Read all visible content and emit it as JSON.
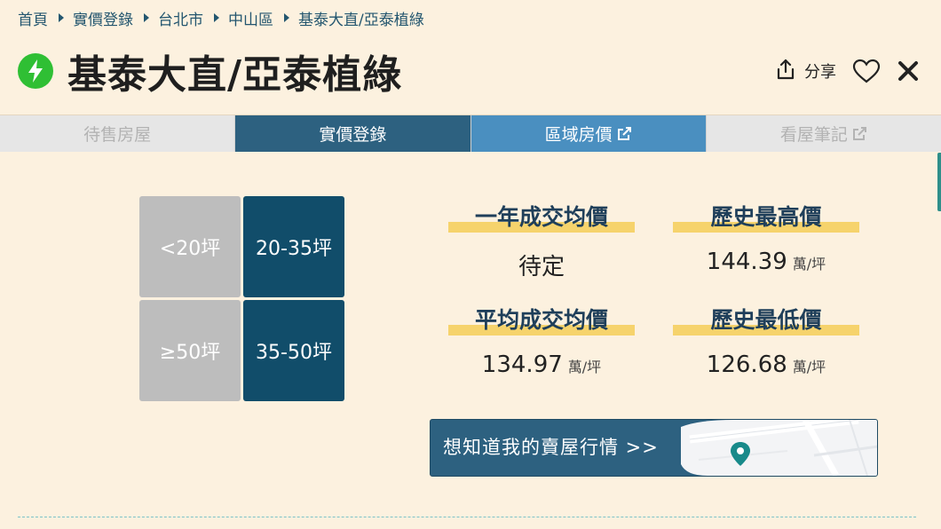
{
  "breadcrumb": [
    "首頁",
    "實價登錄",
    "台北市",
    "中山區",
    "基泰大直/亞泰植綠"
  ],
  "title": "基泰大直/亞泰植綠",
  "actions": {
    "share_label": "分享"
  },
  "tabs": [
    {
      "label": "待售房屋",
      "state": "disabled"
    },
    {
      "label": "實價登錄",
      "state": "active"
    },
    {
      "label": "區域房價",
      "state": "blue",
      "external": true
    },
    {
      "label": "看屋筆記",
      "state": "disabled",
      "external": true
    }
  ],
  "size_filters": {
    "lt20": "<20坪",
    "r20_35": "20-35坪",
    "ge50": "≥50坪",
    "r35_50": "35-50坪"
  },
  "stats": {
    "one_year_avg": {
      "label": "一年成交均價",
      "value": "待定"
    },
    "history_high": {
      "label": "歷史最高價",
      "value": "144.39",
      "unit": "萬/坪"
    },
    "avg_price": {
      "label": "平均成交均價",
      "value": "134.97",
      "unit": "萬/坪"
    },
    "history_low": {
      "label": "歷史最低價",
      "value": "126.68",
      "unit": "萬/坪"
    }
  },
  "banner": {
    "text": "想知道我的賣屋行情 >>"
  },
  "colors": {
    "background": "#fcf1df",
    "primary": "#2d6180",
    "active_size": "#114d6a",
    "highlight": "#f6d36c",
    "bolt": "#2fbf34"
  }
}
